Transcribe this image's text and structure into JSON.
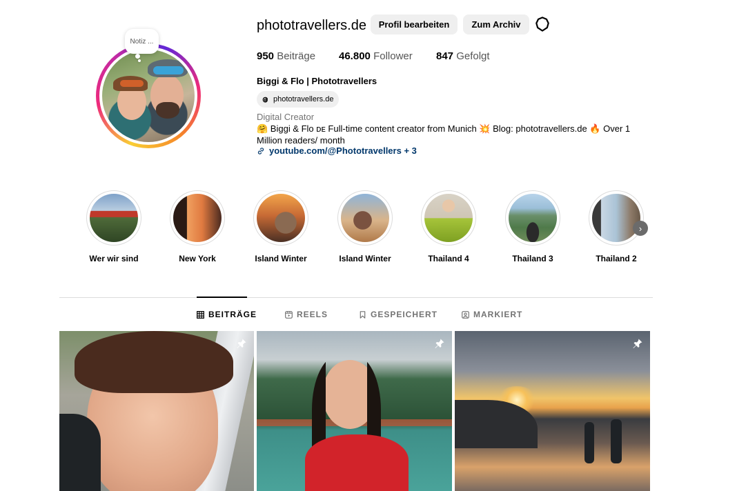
{
  "profile": {
    "username": "phototravellers.de",
    "note": "Notiz ...",
    "edit_button": "Profil bearbeiten",
    "archive_button": "Zum Archiv",
    "settings_icon": "settings-icon",
    "stats": {
      "posts_count": "950",
      "posts_label": "Beiträge",
      "followers_count": "46.800",
      "followers_label": "Follower",
      "following_count": "847",
      "following_label": "Gefolgt"
    },
    "full_name": "Biggi & Flo | Phototravellers",
    "threads_handle": "phototravellers.de",
    "category": "Digital Creator",
    "bio": "🤗 Biggi & Flo ᴅᴇ Full-time content creator from Munich 💥 Blog: phototravellers.de 🔥 Over 1 Million readers/ month",
    "link": "youtube.com/@Phototravellers + 3"
  },
  "highlights": [
    {
      "label": "Wer wir sind"
    },
    {
      "label": "New York"
    },
    {
      "label": "Island Winter"
    },
    {
      "label": "Island Winter"
    },
    {
      "label": "Thailand 4"
    },
    {
      "label": "Thailand 3"
    },
    {
      "label": "Thailand 2"
    }
  ],
  "tabs": [
    {
      "label": "BEITRÄGE",
      "icon": "grid-icon",
      "active": true
    },
    {
      "label": "REELS",
      "icon": "reels-icon",
      "active": false
    },
    {
      "label": "GESPEICHERT",
      "icon": "bookmark-icon",
      "active": false
    },
    {
      "label": "MARKIERT",
      "icon": "tagged-icon",
      "active": false
    }
  ],
  "posts": [
    {
      "pinned": true
    },
    {
      "pinned": true
    },
    {
      "pinned": true
    }
  ]
}
